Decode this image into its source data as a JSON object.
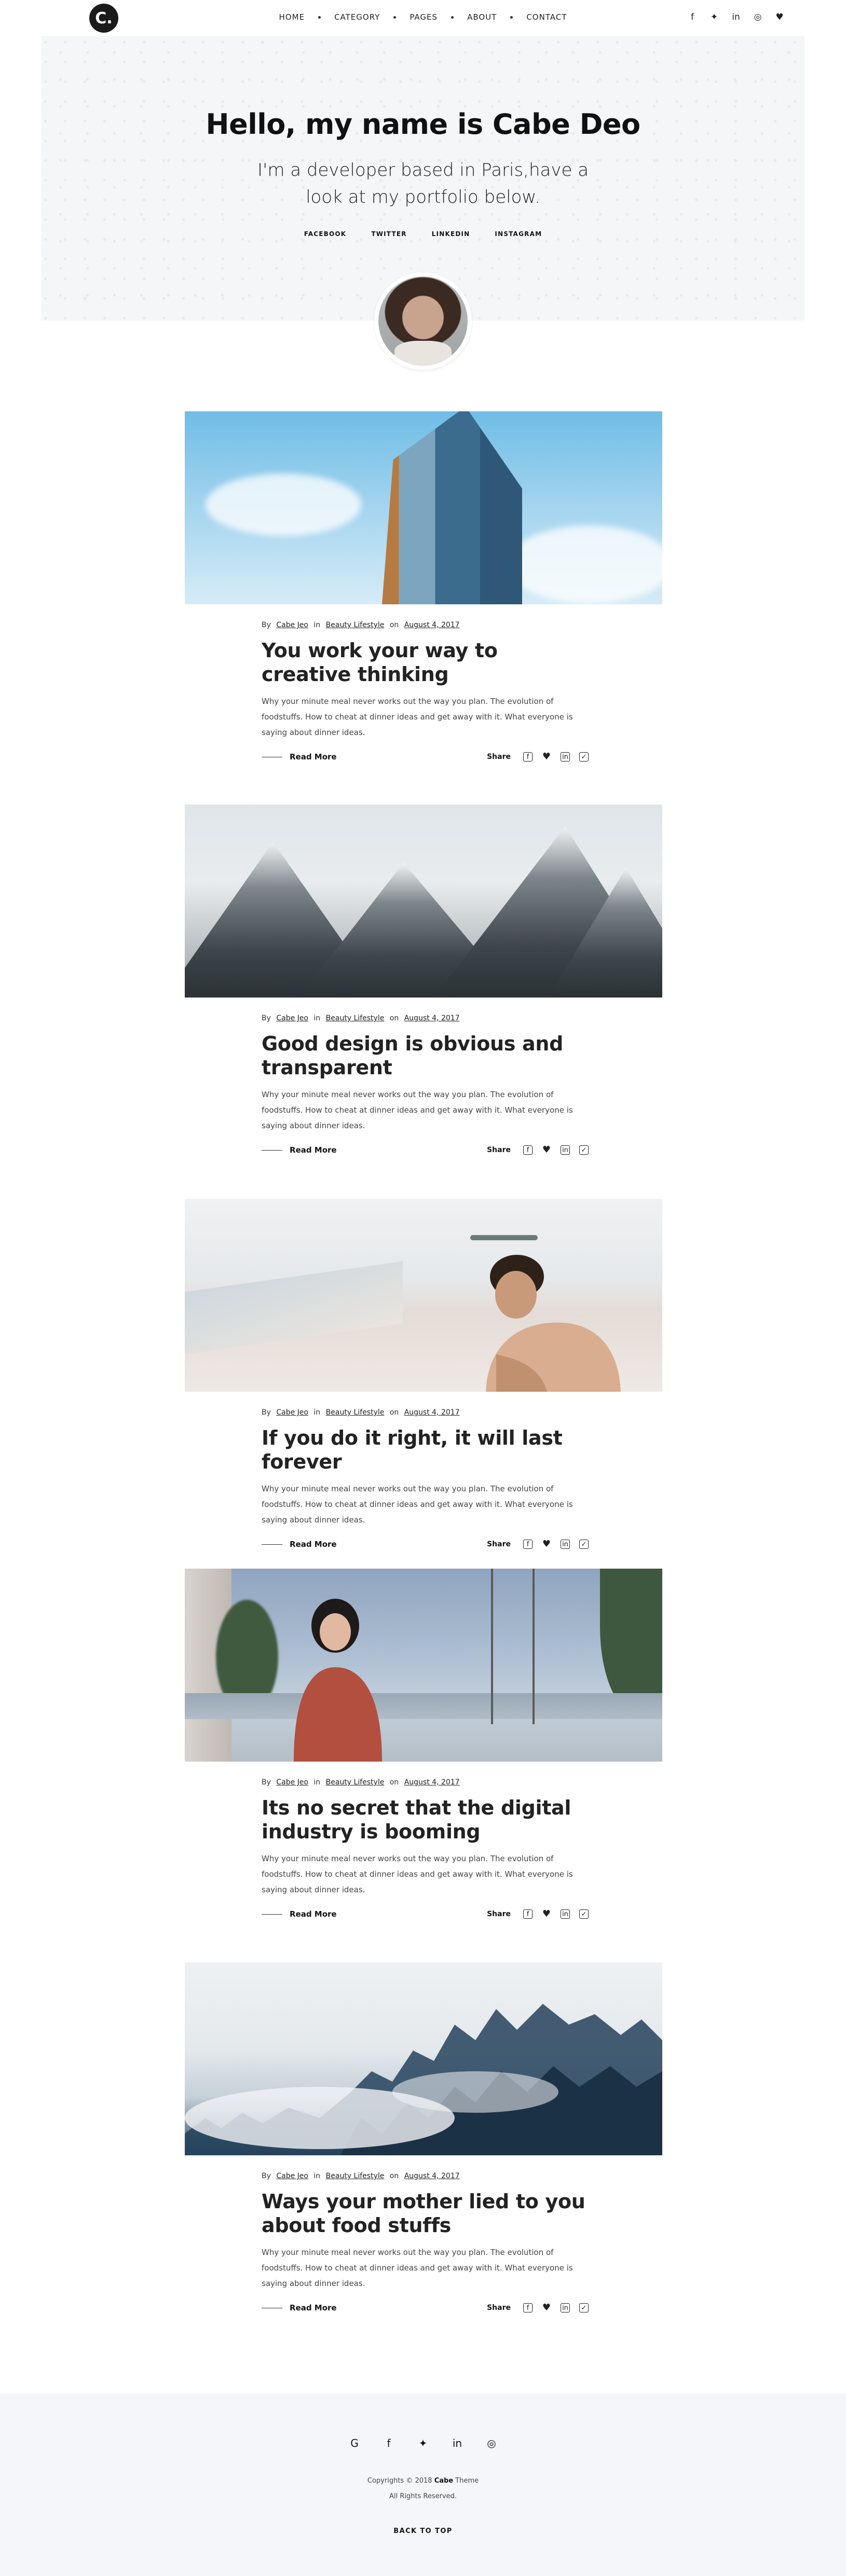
{
  "header": {
    "logo_text": "C.",
    "nav": [
      "HOME",
      "CATEGORY",
      "PAGES",
      "ABOUT",
      "CONTACT"
    ],
    "social_icons": [
      "facebook-icon",
      "twitter-icon",
      "linkedin-icon",
      "instagram-icon",
      "heart-icon"
    ],
    "social_glyphs": [
      "f",
      "✦",
      "in",
      "◎",
      "♥"
    ]
  },
  "hero": {
    "title": "Hello, my name is Cabe Deo",
    "subtitle": "I'm a developer based in Paris,have a look at my portfolio below.",
    "links": [
      "FACEBOOK",
      "TWITTER",
      "LINKEDIN",
      "INSTAGRAM"
    ]
  },
  "post_common": {
    "by": "By",
    "in": "in",
    "on": "on",
    "read_more": "Read More",
    "share": "Share"
  },
  "posts": [
    {
      "author": "Cabe Jeo",
      "category": "Beauty Lifestyle",
      "date": "August 4, 2017",
      "title": "You work your way to creative thinking",
      "excerpt": "Why your minute meal never works out the way you plan. The evolution of foodstuffs. How to cheat at dinner ideas and get away with it. What everyone is saying about dinner ideas."
    },
    {
      "author": "Cabe Jeo",
      "category": "Beauty Lifestyle",
      "date": "August 4, 2017",
      "title": "Good design is obvious and transparent",
      "excerpt": "Why your minute meal never works out the way you plan. The evolution of foodstuffs. How to cheat at dinner ideas and get away with it. What everyone is saying about dinner ideas."
    },
    {
      "author": "Cabe Jeo",
      "category": "Beauty Lifestyle",
      "date": "August 4, 2017",
      "title": "If you do it right, it will last forever",
      "excerpt": "Why your minute meal never works out the way you plan. The evolution of foodstuffs. How to cheat at dinner ideas and get away with it. What everyone is saying about dinner ideas."
    },
    {
      "author": "Cabe Jeo",
      "category": "Beauty Lifestyle",
      "date": "August 4, 2017",
      "title": "Its no secret that the digital industry is booming",
      "excerpt": "Why your minute meal never works out the way you plan. The evolution of foodstuffs. How to cheat at dinner ideas and get away with it. What everyone is saying about dinner ideas."
    },
    {
      "author": "Cabe Jeo",
      "category": "Beauty Lifestyle",
      "date": "August 4, 2017",
      "title": "Ways your mother lied to you about food stuffs",
      "excerpt": "Why your minute meal never works out the way you plan. The evolution of foodstuffs. How to cheat at dinner ideas and get away with it. What everyone is saying about dinner ideas."
    }
  ],
  "footer": {
    "social_icons": [
      "google-icon",
      "facebook-icon",
      "twitter-icon",
      "linkedin-icon",
      "instagram-icon"
    ],
    "social_glyphs": [
      "G",
      "f",
      "✦",
      "in",
      "◎"
    ],
    "copyright_prefix": "Copyrights © 2018",
    "brand": "Cabe",
    "copyright_suffix": "Theme",
    "rights": "All Rights Reserved.",
    "back_to_top": "BACK TO TOP"
  }
}
